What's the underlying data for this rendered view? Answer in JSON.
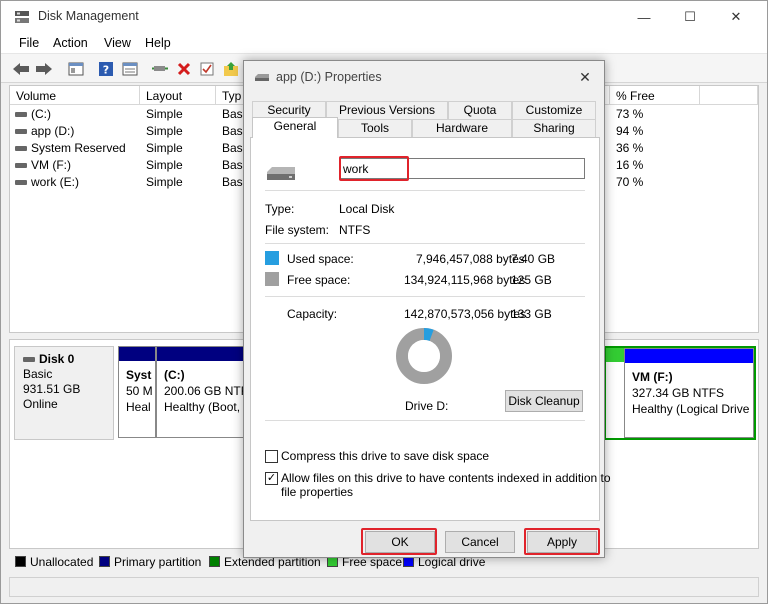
{
  "window": {
    "title": "Disk Management",
    "controls": {
      "minimize": "—",
      "maximize": "☐",
      "close": "✕"
    }
  },
  "menu": [
    "File",
    "Action",
    "View",
    "Help"
  ],
  "volume_table": {
    "headers": [
      "Volume",
      "Layout",
      "Typ",
      "",
      "% Free"
    ],
    "rows": [
      {
        "volume": "(C:)",
        "layout": "Simple",
        "type": "Basi",
        "free": "73 %"
      },
      {
        "volume": "app (D:)",
        "layout": "Simple",
        "type": "Basi",
        "free": "94 %"
      },
      {
        "volume": "System Reserved",
        "layout": "Simple",
        "type": "Basi",
        "free": "36 %"
      },
      {
        "volume": "VM (F:)",
        "layout": "Simple",
        "type": "Basi",
        "free": "16 %"
      },
      {
        "volume": "work (E:)",
        "layout": "Simple",
        "type": "Basi",
        "free": "70 %"
      }
    ]
  },
  "disk": {
    "name": "Disk 0",
    "type": "Basic",
    "size": "931.51 GB",
    "status": "Online",
    "partitions": [
      {
        "name": "Syst",
        "size": "50 M",
        "status": "Heal"
      },
      {
        "name": "(C:)",
        "size": "200.06 GB NTFS",
        "status": "Healthy (Boot, P"
      },
      {
        "name": "VM  (F:)",
        "size": "327.34 GB NTFS",
        "status": "Healthy (Logical Drive"
      }
    ]
  },
  "legend": [
    {
      "label": "Unallocated",
      "color": "#000000"
    },
    {
      "label": "Primary partition",
      "color": "#000080"
    },
    {
      "label": "Extended partition",
      "color": "#008000"
    },
    {
      "label": "Free space",
      "color": "#33cc33"
    },
    {
      "label": "Logical drive",
      "color": "#0000ff"
    }
  ],
  "dialog": {
    "title": "app (D:) Properties",
    "close": "✕",
    "tabs_top": [
      "Security",
      "Previous Versions",
      "Quota",
      "Customize"
    ],
    "tabs_bottom": [
      "General",
      "Tools",
      "Hardware",
      "Sharing"
    ],
    "active_tab": "General",
    "name_value": "work",
    "type_label": "Type:",
    "type_value": "Local Disk",
    "fs_label": "File system:",
    "fs_value": "NTFS",
    "used": {
      "label": "Used space:",
      "bytes": "7,946,457,088 bytes",
      "size": "7.40 GB",
      "color": "#269ee0"
    },
    "free": {
      "label": "Free space:",
      "bytes": "134,924,115,968 bytes",
      "size": "125 GB",
      "color": "#a0a0a0"
    },
    "capacity": {
      "label": "Capacity:",
      "bytes": "142,870,573,056 bytes",
      "size": "133 GB"
    },
    "used_fraction": 0.056,
    "drive_label": "Drive D:",
    "disk_cleanup": "Disk Cleanup",
    "compress_label": "Compress this drive to save disk space",
    "compress_checked": false,
    "index_label_1": "Allow files on this drive to have contents indexed in addition to",
    "index_label_2": "file properties",
    "index_checked": true,
    "buttons": {
      "ok": "OK",
      "cancel": "Cancel",
      "apply": "Apply"
    }
  },
  "colors": {
    "highlight": "#e0232b",
    "primary": "#000080",
    "logical": "#0000ff",
    "free_space": "#33cc33"
  }
}
